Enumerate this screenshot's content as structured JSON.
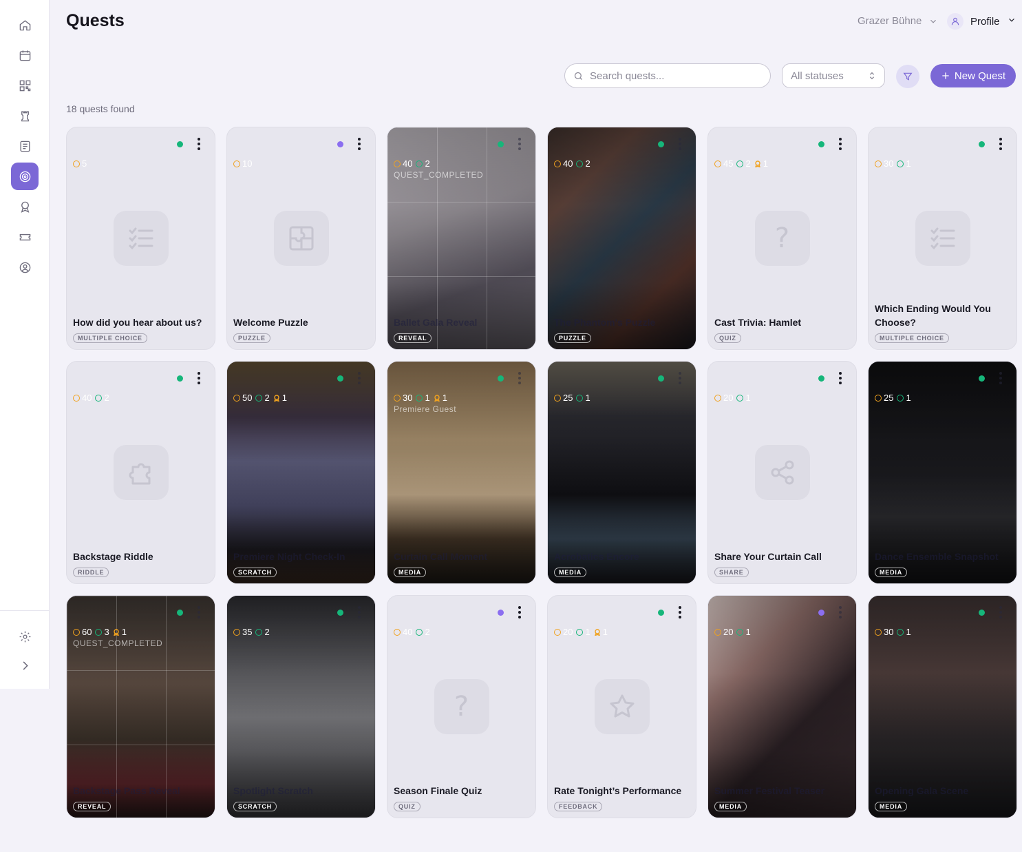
{
  "page": {
    "title": "Quests"
  },
  "header": {
    "org": "Grazer Bühne",
    "profile": "Profile"
  },
  "toolbar": {
    "search_placeholder": "Search quests...",
    "status_filter": "All statuses",
    "new_quest_label": "New Quest"
  },
  "results": {
    "count_text": "18 quests found"
  },
  "sidebar": {
    "items": [
      {
        "icon": "home-icon"
      },
      {
        "icon": "calendar-icon"
      },
      {
        "icon": "qr-code-icon"
      },
      {
        "icon": "chess-rook-icon"
      },
      {
        "icon": "document-list-icon"
      },
      {
        "icon": "target-icon",
        "active": true
      },
      {
        "icon": "award-icon"
      },
      {
        "icon": "ticket-icon"
      },
      {
        "icon": "user-circle-icon"
      }
    ],
    "bottom": [
      {
        "icon": "gear-icon"
      },
      {
        "icon": "chevron-right-icon"
      }
    ]
  },
  "quests": [
    {
      "title": "How did you hear about us?",
      "type": "MULTIPLE CHOICE",
      "status": "active",
      "coins": "5",
      "icon": "checklist-icon"
    },
    {
      "title": "Welcome Puzzle",
      "type": "PUZZLE",
      "status": "draft",
      "coins": "10",
      "icon": "puzzle-square-icon"
    },
    {
      "title": "Ballet Gala Reveal",
      "type": "REVEAL",
      "status": "active",
      "coins": "40",
      "checks": "2",
      "image": "ballet",
      "note": "QUEST_COMPLETED"
    },
    {
      "title": "The Phantom's Puzzle",
      "type": "PUZZLE",
      "status": "active",
      "coins": "40",
      "checks": "2",
      "image": "dolls"
    },
    {
      "title": "Cast Trivia: Hamlet",
      "type": "QUIZ",
      "status": "active",
      "coins": "45",
      "checks": "2",
      "awards": "1",
      "icon": "question-icon"
    },
    {
      "title": "Which Ending Would You Choose?",
      "type": "MULTIPLE CHOICE",
      "status": "active",
      "coins": "30",
      "checks": "1",
      "icon": "checklist-icon"
    },
    {
      "title": "Backstage Riddle",
      "type": "RIDDLE",
      "status": "active",
      "coins": "40",
      "checks": "2",
      "icon": "puzzle-piece-icon"
    },
    {
      "title": "Premiere Night Check-In",
      "type": "SCRATCH",
      "status": "active",
      "coins": "50",
      "checks": "2",
      "awards": "1",
      "image": "stage"
    },
    {
      "title": "Curtain Call Moment",
      "type": "MEDIA",
      "status": "active",
      "coins": "30",
      "checks": "1",
      "awards": "1",
      "image": "kids",
      "note": "Premiere Guest"
    },
    {
      "title": "Acrobatics Encore",
      "type": "MEDIA",
      "status": "active",
      "coins": "25",
      "checks": "1",
      "image": "acrobat"
    },
    {
      "title": "Share Your Curtain Call",
      "type": "SHARE",
      "status": "active",
      "coins": "20",
      "checks": "1",
      "icon": "share-icon"
    },
    {
      "title": "Dance Ensemble Snapshot",
      "type": "MEDIA",
      "status": "active",
      "coins": "25",
      "checks": "1",
      "image": "ensemble"
    },
    {
      "title": "Backstage Pass Reveal",
      "type": "REVEAL",
      "status": "active",
      "coins": "60",
      "checks": "3",
      "awards": "1",
      "image": "concert",
      "note": "QUEST_COMPLETED"
    },
    {
      "title": "Spotlight Scratch",
      "type": "SCRATCH",
      "status": "active",
      "coins": "35",
      "checks": "2",
      "image": "audience"
    },
    {
      "title": "Season Finale Quiz",
      "type": "QUIZ",
      "status": "draft",
      "coins": "40",
      "checks": "2",
      "icon": "question-icon"
    },
    {
      "title": "Rate Tonight’s Performance",
      "type": "FEEDBACK",
      "status": "active",
      "coins": "20",
      "checks": "1",
      "awards": "1",
      "icon": "star-icon"
    },
    {
      "title": "Summer Festival Teaser",
      "type": "MEDIA",
      "status": "draft",
      "coins": "20",
      "checks": "1",
      "image": "dancers"
    },
    {
      "title": "Opening Gala Scene",
      "type": "MEDIA",
      "status": "active",
      "coins": "30",
      "checks": "1",
      "image": "singer"
    }
  ],
  "colors": {
    "accent": "#7b68d6",
    "active": "#16b67a",
    "draft": "#8b6ef0",
    "coin": "#f0a21f"
  }
}
